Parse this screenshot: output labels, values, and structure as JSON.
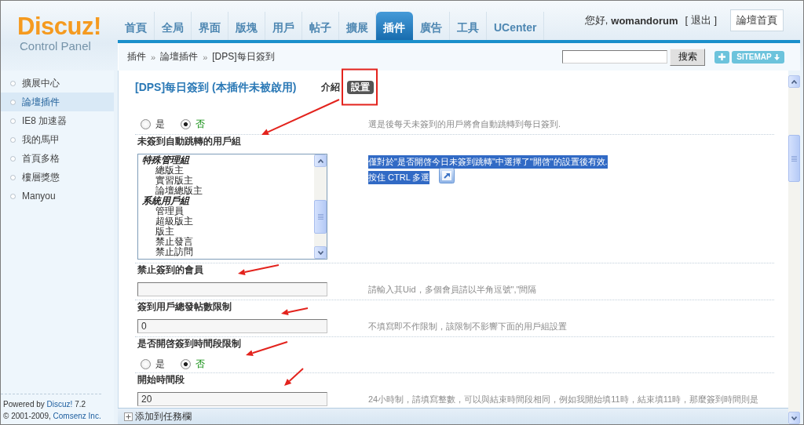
{
  "header": {
    "logo": {
      "title": "Discuz!",
      "subtitle": "Control Panel"
    },
    "nav_tabs": [
      {
        "label": "首頁",
        "selected": false
      },
      {
        "label": "全局",
        "selected": false
      },
      {
        "label": "界面",
        "selected": false
      },
      {
        "label": "版塊",
        "selected": false
      },
      {
        "label": "用戶",
        "selected": false
      },
      {
        "label": "帖子",
        "selected": false
      },
      {
        "label": "擴展",
        "selected": false
      },
      {
        "label": "插件",
        "selected": true
      },
      {
        "label": "廣告",
        "selected": false
      },
      {
        "label": "工具",
        "selected": false
      },
      {
        "label": "UCenter",
        "selected": false
      }
    ],
    "user": {
      "greeting": "您好,",
      "username": "womandorum",
      "logout": "[ 退出 ]"
    },
    "home_button": "論壇首頁"
  },
  "breadcrumb": [
    {
      "kind": "link",
      "text": "插件"
    },
    {
      "kind": "separator",
      "text": "»"
    },
    {
      "kind": "link",
      "text": "論壇插件"
    },
    {
      "kind": "separator",
      "text": "»"
    },
    {
      "kind": "current",
      "text": "[DPS]每日簽到"
    }
  ],
  "toolbar": {
    "search_button": "搜索",
    "sitemap_button": "SITEMAP"
  },
  "sidebar": {
    "items": [
      {
        "label": "擴展中心",
        "selected": false
      },
      {
        "label": "論壇插件",
        "selected": true
      },
      {
        "label": "IE8 加速器",
        "selected": false
      },
      {
        "label": "我的馬甲",
        "selected": false
      },
      {
        "label": "首頁多格",
        "selected": false
      },
      {
        "label": "樓層獎懲",
        "selected": false
      },
      {
        "label": "Manyou",
        "selected": false
      }
    ],
    "footer": [
      {
        "text": "Powered by",
        "link": "Discuz!",
        "suffix": "7.2"
      },
      {
        "text": "© 2001-2009,",
        "link": "Comsenz Inc."
      }
    ]
  },
  "plugin": {
    "title": "[DPS]每日簽到 (本插件未被啟用)",
    "tabs": [
      {
        "label": "介紹",
        "selected": false
      },
      {
        "label": "設置",
        "selected": true
      }
    ]
  },
  "settings": [
    {
      "kind": "radio",
      "options": [
        {
          "label": "是",
          "selected": false
        },
        {
          "label": "否",
          "selected": true
        }
      ],
      "help": "選是後每天未簽到的用戶將會自動跳轉到每日簽到."
    },
    {
      "kind": "multiselect",
      "label": "未簽到自動跳轉的用戶組",
      "groups": [
        {
          "label": "特殊管理組",
          "options": [
            {
              "label": "總版主",
              "selected": false
            },
            {
              "label": "實習版主",
              "selected": false
            },
            {
              "label": "論壇總版主",
              "selected": false
            }
          ]
        },
        {
          "label": "系統用戶組",
          "options": [
            {
              "label": "管理員",
              "selected": false
            },
            {
              "label": "超級版主",
              "selected": false
            },
            {
              "label": "版主",
              "selected": false
            },
            {
              "label": "禁止發言",
              "selected": false
            },
            {
              "label": "禁止訪問",
              "selected": false
            }
          ]
        }
      ],
      "help": [
        "僅對於\"是否開啓今日未簽到跳轉\"中選擇了\"開啓\"的設置後有效.",
        "按住 CTRL 多選"
      ],
      "highlighted": true
    },
    {
      "kind": "text",
      "label": "禁止簽到的會員",
      "help": "請輸入其Uid，多個會員請以半角逗號\",\"間隔"
    },
    {
      "kind": "text",
      "label": "簽到用戶總發帖數限制",
      "value": "0",
      "help": "不填寫即不作限制，該限制不影響下面的用戶組設置"
    },
    {
      "kind": "radio",
      "label": "是否開啓簽到時間段限制",
      "options": [
        {
          "label": "是",
          "selected": false
        },
        {
          "label": "否",
          "selected": true
        }
      ]
    },
    {
      "kind": "text",
      "label": "開始時間段",
      "value": "20",
      "help": "24小時制，請填寫整數，可以與結束時間段相同，例如我開始填11時，結束填11時，那麼簽到時間則是"
    }
  ],
  "taskbar": {
    "label": "添加到任務欄"
  }
}
